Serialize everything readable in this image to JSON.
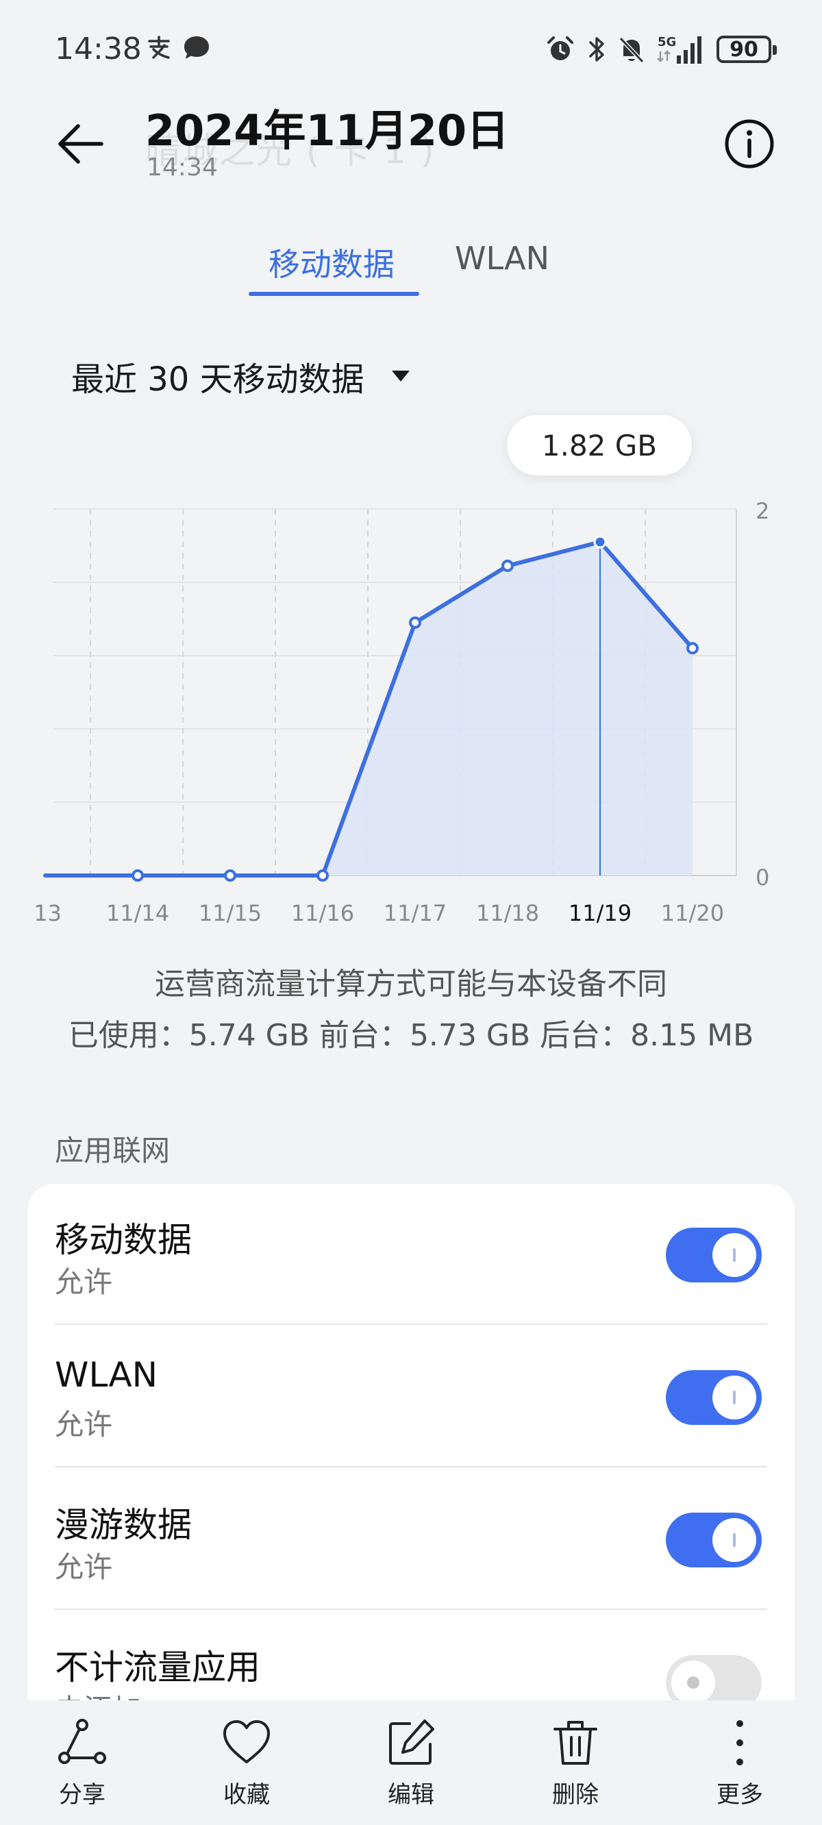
{
  "status_bar": {
    "time": "14:38",
    "left_icons": [
      "alipay-icon",
      "message-icon"
    ],
    "right_icons": [
      "alarm-icon",
      "bluetooth-icon",
      "mute-icon",
      "5g-signal-icon"
    ],
    "battery": "90"
  },
  "header": {
    "title": "2024年11月20日",
    "subtitle": "14:34",
    "ghost_title": "晴城之光 ( 卡 1 )"
  },
  "tabs": [
    {
      "label": "移动数据",
      "active": true
    },
    {
      "label": "WLAN",
      "active": false
    }
  ],
  "period": {
    "label": "最近 30 天移动数据"
  },
  "chart_data": {
    "type": "area",
    "x": [
      "11/13",
      "11/14",
      "11/15",
      "11/16",
      "11/17",
      "11/18",
      "11/19",
      "11/20"
    ],
    "values": [
      0,
      0,
      0,
      0,
      1.38,
      1.69,
      1.82,
      1.24
    ],
    "x_tick_labels": [
      "13",
      "11/14",
      "11/15",
      "11/16",
      "11/17",
      "11/18",
      "11/19",
      "11/20"
    ],
    "y_tick_labels": [
      "2",
      "0"
    ],
    "ylim": [
      0,
      2
    ],
    "highlight_x": "11/19",
    "tooltip": "1.82 GB",
    "colors": {
      "line": "#3d6fe0",
      "fill": "#dce4f7"
    }
  },
  "notes": {
    "line1": "运营商流量计算方式可能与本设备不同",
    "line2": "已使用：5.74 GB 前台：5.73 GB 后台：8.15 MB"
  },
  "section": {
    "label": "应用联网"
  },
  "settings": [
    {
      "title": "移动数据",
      "subtitle": "允许",
      "on": true
    },
    {
      "title": "WLAN",
      "subtitle": "允许",
      "on": true
    },
    {
      "title": "漫游数据",
      "subtitle": "允许",
      "on": true
    },
    {
      "title": "不计流量应用",
      "subtitle": "未添加",
      "on": false
    }
  ],
  "toolbar": {
    "share": "分享",
    "favorite": "收藏",
    "edit": "编辑",
    "delete": "删除",
    "more": "更多"
  }
}
